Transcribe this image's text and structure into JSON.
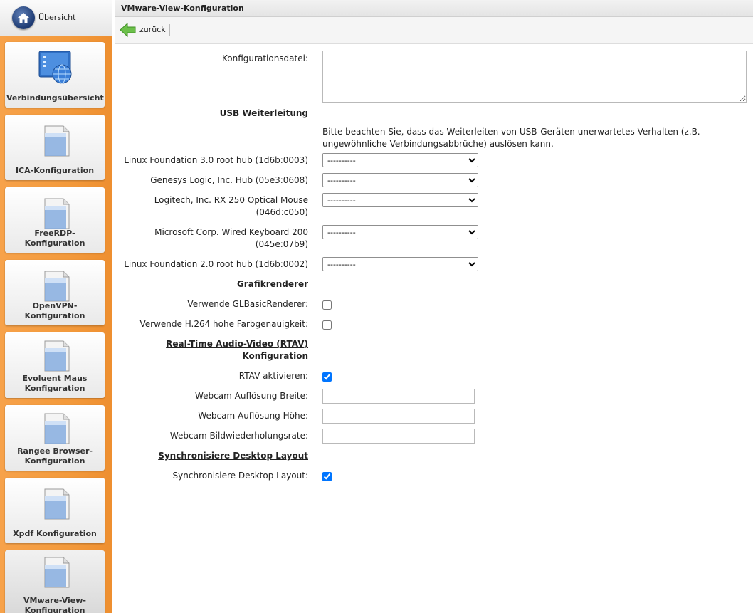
{
  "sidebar": {
    "home_label": "Übersicht",
    "items": [
      {
        "label": "Verbindungsübersicht",
        "icon": "network-overview-icon"
      },
      {
        "label": "ICA-Konfiguration",
        "icon": "document-icon"
      },
      {
        "label": "FreeRDP-Konfiguration",
        "icon": "document-icon"
      },
      {
        "label": "OpenVPN-Konfiguration",
        "icon": "document-icon"
      },
      {
        "label": "Evoluent Maus Konfiguration",
        "icon": "document-icon"
      },
      {
        "label": "Rangee Browser-Konfiguration",
        "icon": "document-icon"
      },
      {
        "label": "Xpdf Konfiguration",
        "icon": "document-icon"
      },
      {
        "label": "VMware-View-Konfiguration",
        "icon": "document-icon"
      }
    ]
  },
  "header": {
    "title": "VMware-View-Konfiguration"
  },
  "toolbar": {
    "back_label": "zurück"
  },
  "form": {
    "config_file_label": "Konfigurationsdatei:",
    "config_file_value": "",
    "usb_section": "USB Weiterleitung",
    "usb_hint": "Bitte beachten Sie, dass das Weiterleiten von USB-Geräten unerwartetes Verhalten (z.B. ungewöhnliche Verbindungsabbrüche) auslösen kann.",
    "usb_devices": [
      {
        "label": "Linux Foundation 3.0 root hub (1d6b:0003)",
        "value": "----------"
      },
      {
        "label": "Genesys Logic, Inc. Hub (05e3:0608)",
        "value": "----------"
      },
      {
        "label_line1": "Logitech, Inc. RX 250 Optical Mouse",
        "label_line2": "(046d:c050)",
        "value": "----------"
      },
      {
        "label_line1": "Microsoft Corp. Wired Keyboard 200",
        "label_line2": "(045e:07b9)",
        "value": "----------"
      },
      {
        "label": "Linux Foundation 2.0 root hub (1d6b:0002)",
        "value": "----------"
      }
    ],
    "graphics_section": "Grafikrenderer",
    "gl_basic_label": "Verwende GLBasicRenderer:",
    "gl_basic_checked": false,
    "h264_label": "Verwende H.264 hohe Farbgenauigkeit:",
    "h264_checked": false,
    "rtav_section_line1": "Real-Time Audio-Video (RTAV)",
    "rtav_section_line2": "Konfiguration",
    "rtav_enable_label": "RTAV aktivieren:",
    "rtav_enable_checked": true,
    "webcam_width_label": "Webcam Auflösung Breite:",
    "webcam_width_value": "",
    "webcam_height_label": "Webcam Auflösung Höhe:",
    "webcam_height_value": "",
    "webcam_fps_label": "Webcam Bildwiederholungsrate:",
    "webcam_fps_value": "",
    "sync_section": "Synchronisiere Desktop Layout",
    "sync_label": "Synchronisiere Desktop Layout:",
    "sync_checked": true
  }
}
